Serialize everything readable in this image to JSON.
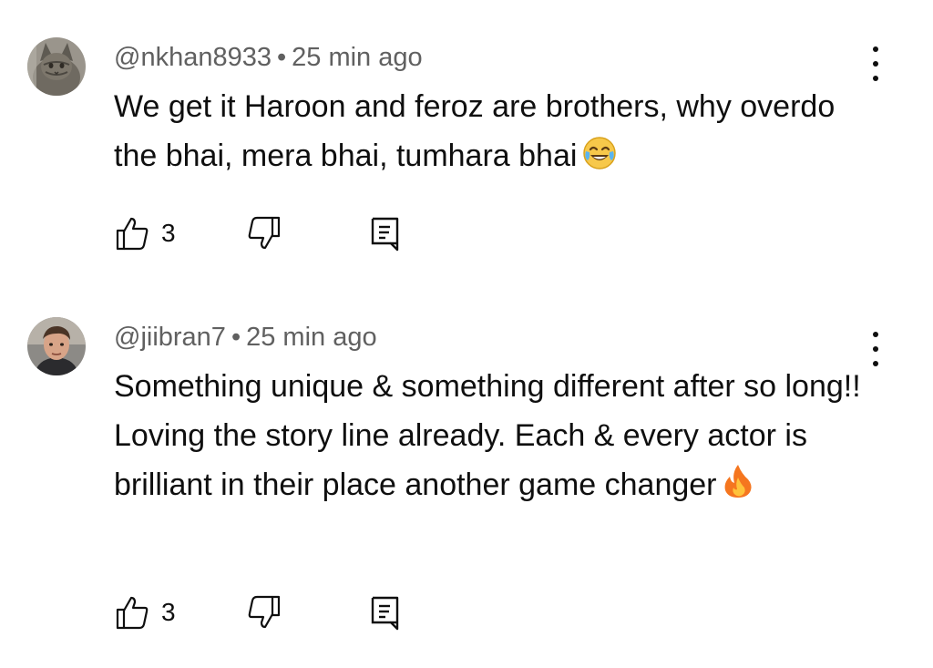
{
  "comments": [
    {
      "handle": "@nkhan8933",
      "separator": "•",
      "time": "25 min ago",
      "text": "We get it Haroon and feroz are brothers, why overdo the bhai, mera bhai, tumhara bhai",
      "emoji": "face-with-tears-of-joy",
      "likes": "3",
      "avatar": "cat-avatar"
    },
    {
      "handle": "@jiibran7",
      "separator": "•",
      "time": "25 min ago",
      "text": "Something unique & something different after so long!! Loving the story line already. Each & every actor is brilliant in their place another game changer",
      "emoji": "fire",
      "likes": "3",
      "avatar": "person-avatar"
    }
  ],
  "colors": {
    "text": "#0f0f0f",
    "meta": "#606060",
    "background": "#ffffff"
  },
  "icons": [
    "thumb-up-icon",
    "thumb-down-icon",
    "reply-icon",
    "more-vert-icon"
  ]
}
